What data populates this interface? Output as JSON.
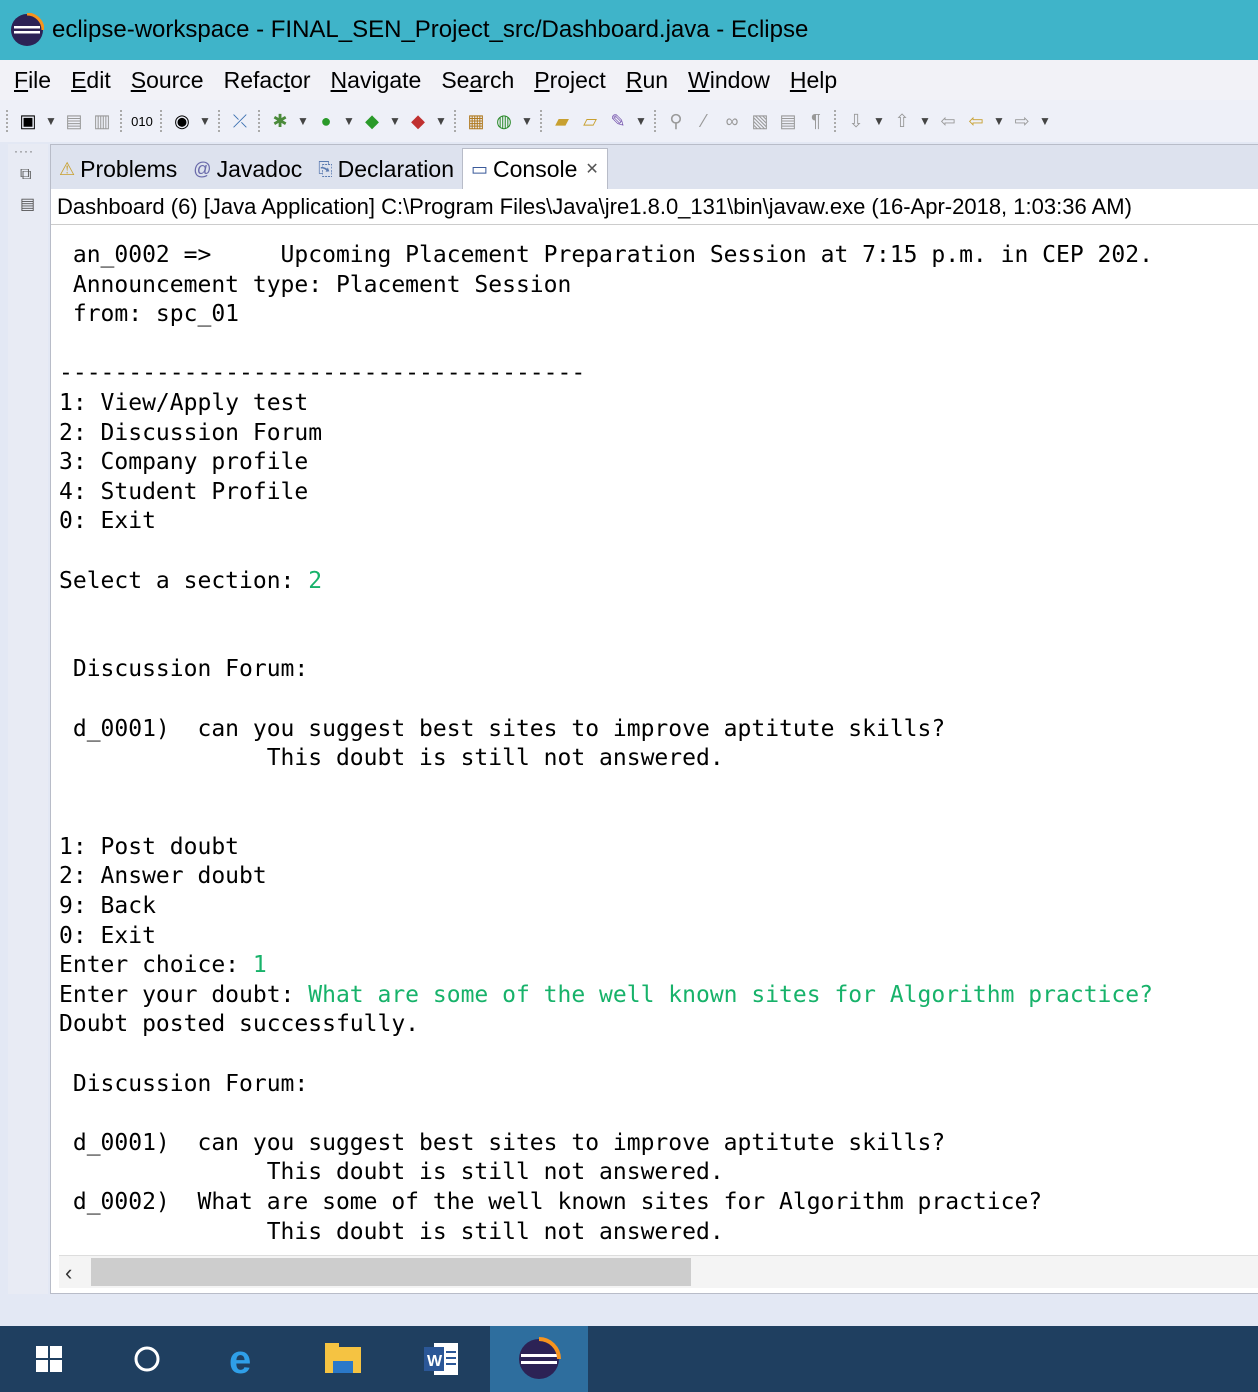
{
  "window": {
    "title": "eclipse-workspace - FINAL_SEN_Project_src/Dashboard.java - Eclipse"
  },
  "menu": [
    {
      "label": "File",
      "mnemonic": "F"
    },
    {
      "label": "Edit",
      "mnemonic": "E"
    },
    {
      "label": "Source",
      "mnemonic": "S"
    },
    {
      "label": "Refactor",
      "mnemonic": "t"
    },
    {
      "label": "Navigate",
      "mnemonic": "N"
    },
    {
      "label": "Search",
      "mnemonic": "a"
    },
    {
      "label": "Project",
      "mnemonic": "P"
    },
    {
      "label": "Run",
      "mnemonic": "R"
    },
    {
      "label": "Window",
      "mnemonic": "W"
    },
    {
      "label": "Help",
      "mnemonic": "H"
    }
  ],
  "tabs": [
    {
      "label": "Problems",
      "icon": "problems-icon",
      "active": false
    },
    {
      "label": "Javadoc",
      "icon": "javadoc-icon",
      "active": false
    },
    {
      "label": "Declaration",
      "icon": "declaration-icon",
      "active": false
    },
    {
      "label": "Console",
      "icon": "console-icon",
      "active": true
    }
  ],
  "console_header": "Dashboard (6) [Java Application] C:\\Program Files\\Java\\jre1.8.0_131\\bin\\javaw.exe (16-Apr-2018, 1:03:36 AM)",
  "console_lines": [
    {
      "text": " an_0002 =>     Upcoming Placement Preparation Session at 7:15 p.m. in CEP 202.",
      "input": ""
    },
    {
      "text": " Announcement type: Placement Session",
      "input": ""
    },
    {
      "text": " from: spc_01",
      "input": ""
    },
    {
      "text": "",
      "input": ""
    },
    {
      "text": "--------------------------------------",
      "input": ""
    },
    {
      "text": "1: View/Apply test",
      "input": ""
    },
    {
      "text": "2: Discussion Forum",
      "input": ""
    },
    {
      "text": "3: Company profile",
      "input": ""
    },
    {
      "text": "4: Student Profile",
      "input": ""
    },
    {
      "text": "0: Exit",
      "input": ""
    },
    {
      "text": "",
      "input": ""
    },
    {
      "text": "Select a section: ",
      "input": "2"
    },
    {
      "text": "",
      "input": ""
    },
    {
      "text": "",
      "input": ""
    },
    {
      "text": " Discussion Forum:",
      "input": ""
    },
    {
      "text": "",
      "input": ""
    },
    {
      "text": " d_0001)  can you suggest best sites to improve aptitute skills?",
      "input": ""
    },
    {
      "text": "               This doubt is still not answered.",
      "input": ""
    },
    {
      "text": "",
      "input": ""
    },
    {
      "text": "",
      "input": ""
    },
    {
      "text": "1: Post doubt",
      "input": ""
    },
    {
      "text": "2: Answer doubt",
      "input": ""
    },
    {
      "text": "9: Back",
      "input": ""
    },
    {
      "text": "0: Exit",
      "input": ""
    },
    {
      "text": "Enter choice: ",
      "input": "1"
    },
    {
      "text": "Enter your doubt: ",
      "input": "What are some of the well known sites for Algorithm practice?"
    },
    {
      "text": "Doubt posted successfully.",
      "input": ""
    },
    {
      "text": "",
      "input": ""
    },
    {
      "text": " Discussion Forum:",
      "input": ""
    },
    {
      "text": "",
      "input": ""
    },
    {
      "text": " d_0001)  can you suggest best sites to improve aptitute skills?",
      "input": ""
    },
    {
      "text": "               This doubt is still not answered.",
      "input": ""
    },
    {
      "text": " d_0002)  What are some of the well known sites for Algorithm practice?",
      "input": ""
    },
    {
      "text": "               This doubt is still not answered.",
      "input": ""
    }
  ],
  "colors": {
    "titlebar": "#3fb4c9",
    "console_input": "#17b26a",
    "taskbar": "#1f3f60"
  },
  "taskbar_items": [
    {
      "name": "start-icon"
    },
    {
      "name": "search-circle-icon"
    },
    {
      "name": "edge-icon"
    },
    {
      "name": "file-explorer-icon"
    },
    {
      "name": "word-icon"
    },
    {
      "name": "eclipse-icon",
      "active": true
    }
  ]
}
